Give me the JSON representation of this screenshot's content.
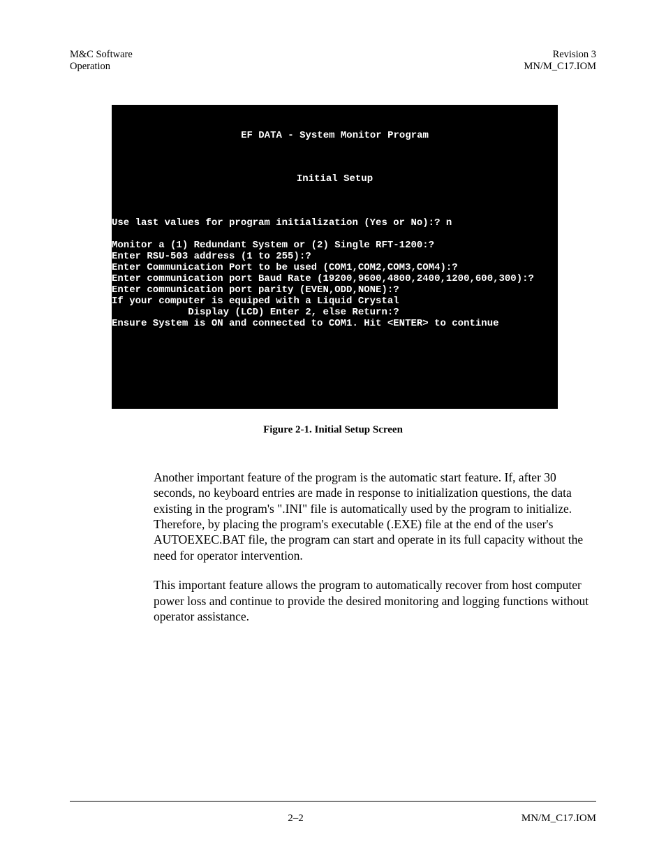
{
  "header": {
    "left_line1": "M&C Software",
    "left_line2": "Operation",
    "right_line1": "Revision 3",
    "right_line2": "MN/M_C17.IOM"
  },
  "terminal": {
    "title1": "EF DATA - System Monitor Program",
    "title2": "Initial Setup",
    "lines": "Use last values for program initialization (Yes or No):? n\n\nMonitor a (1) Redundant System or (2) Single RFT-1200:?\nEnter RSU-503 address (1 to 255):?\nEnter Communication Port to be used (COM1,COM2,COM3,COM4):?\nEnter communication port Baud Rate (19200,9600,4800,2400,1200,600,300):?\nEnter communication port parity (EVEN,ODD,NONE):?\nIf your computer is equiped with a Liquid Crystal\n             Display (LCD) Enter 2, else Return:?\nEnsure System is ON and connected to COM1. Hit <ENTER> to continue"
  },
  "caption": "Figure 2-1.  Initial Setup Screen",
  "paragraphs": {
    "p1": "Another important feature of the program is the automatic start feature. If, after 30 seconds, no keyboard entries are made in response to initialization questions, the data existing in the program's \".INI\" file is automatically used by the program to initialize. Therefore, by placing the program's executable (.EXE) file at the end of the user's AUTOEXEC.BAT file, the program can start and operate in its full capacity without the need for operator intervention.",
    "p2": "This important feature allows the program to automatically recover from host computer power loss and continue to provide the desired monitoring and logging functions without operator assistance."
  },
  "footer": {
    "center": "2–2",
    "right": "MN/M_C17.IOM"
  }
}
